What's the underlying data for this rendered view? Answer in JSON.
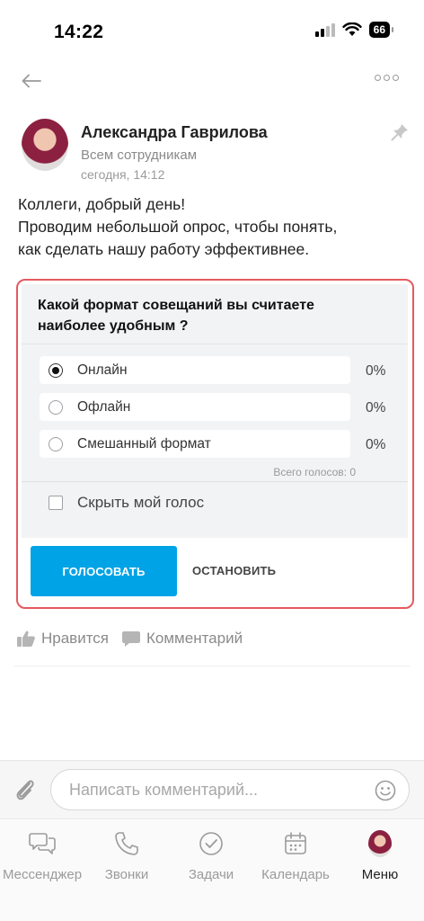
{
  "status_bar": {
    "time": "14:22",
    "battery": "66"
  },
  "post": {
    "author": "Александра Гаврилова",
    "recipient": "Всем сотрудникам",
    "time": "сегодня, 14:12",
    "text_line1": "Коллеги, добрый день!",
    "text_line2": "Проводим небольшой опрос, чтобы понять,",
    "text_line3": "как сделать нашу работу эффективнее."
  },
  "poll": {
    "question_line1": "Какой формат совещаний вы считаете",
    "question_line2": "наиболее удобным ?",
    "options": [
      {
        "label": "Онлайн",
        "percent": "0%",
        "selected": true
      },
      {
        "label": "Офлайн",
        "percent": "0%",
        "selected": false
      },
      {
        "label": "Смешанный формат",
        "percent": "0%",
        "selected": false
      }
    ],
    "total_votes": "Всего голосов: 0",
    "hide_vote_label": "Скрыть мой голос",
    "vote_button": "ГОЛОСОВАТЬ",
    "stop_button": "ОСТАНОВИТЬ"
  },
  "actions": {
    "like": "Нравится",
    "comment": "Комментарий"
  },
  "comment_bar": {
    "placeholder": "Написать комментарий..."
  },
  "tabs": [
    {
      "label": "Мессенджер",
      "icon": "chat-icon"
    },
    {
      "label": "Звонки",
      "icon": "phone-icon"
    },
    {
      "label": "Задачи",
      "icon": "check-circle-icon"
    },
    {
      "label": "Календарь",
      "icon": "calendar-icon"
    },
    {
      "label": "Меню",
      "icon": "avatar",
      "active": true
    }
  ],
  "colors": {
    "accent": "#00a3e6",
    "highlight_border": "#e45a5f"
  }
}
